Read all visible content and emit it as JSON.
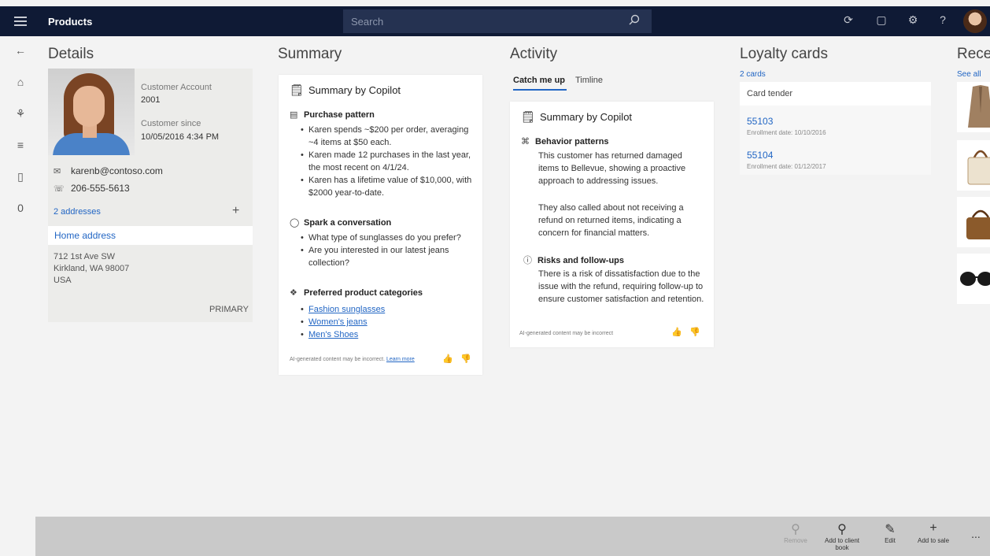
{
  "header": {
    "app_title": "Products",
    "search_placeholder": "Search",
    "icons": [
      "menu-icon",
      "search-icon",
      "refresh-icon",
      "chat-icon",
      "settings-icon",
      "help-icon",
      "avatar"
    ]
  },
  "rail": {
    "items": [
      "back-icon",
      "home-icon",
      "team-icon",
      "list-icon",
      "bag-icon",
      "zero-badge"
    ],
    "zero_label": "0"
  },
  "details": {
    "heading": "Details",
    "account_label": "Customer Account",
    "account_value": "2001",
    "since_label": "Customer since",
    "since_value": "10/05/2016 4:34 PM",
    "email": "karenb@contoso.com",
    "phone": "206-555-5613",
    "addresses_link": "2 addresses",
    "add_symbol": "+",
    "home_address_label": "Home address",
    "address_lines": [
      "712 1st Ave SW",
      "Kirkland, WA 98007",
      "USA"
    ],
    "primary_label": "PRIMARY"
  },
  "summary": {
    "heading": "Summary",
    "card_title": "Summary by Copilot",
    "purchase_title": "Purchase pattern",
    "purchase_bullets": [
      "Karen spends ~$200 per order, averaging ~4 items at $50 each.",
      "Karen made 12 purchases in the last year, the most recent on 4/1/24.",
      "Karen has a lifetime value of $10,000, with $2000 year-to-date."
    ],
    "conversation_title": "Spark a conversation",
    "conversation_bullets": [
      "What type of sunglasses do you prefer?",
      "Are you interested in our latest jeans collection?"
    ],
    "categories_title": "Preferred product categories",
    "categories": [
      "Fashion sunglasses",
      "Women's jeans",
      "Men's Shoes"
    ],
    "disclaimer": "AI-generated content may be incorrect.",
    "learn_more": "Learn more"
  },
  "activity": {
    "heading": "Activity",
    "tabs": [
      "Catch me up",
      "Timline"
    ],
    "card_title": "Summary by Copilot",
    "behavior_title": "Behavior patterns",
    "behavior_p1": "This customer has returned damaged items to Bellevue, showing a proactive approach to addressing issues.",
    "behavior_p2": "They also called about not receiving a refund on returned items, indicating a concern for financial matters.",
    "risks_title": "Risks and follow-ups",
    "risks_p": "There is a risk of dissatisfaction due to the issue with the refund, requiring follow-up to ensure customer satisfaction and retention.",
    "disclaimer": "AI-generated content may be incorrect"
  },
  "loyalty": {
    "heading": "Loyalty cards",
    "count_link": "2 cards",
    "tender_label": "Card tender",
    "cards": [
      {
        "number": "55103",
        "date": "Enrollment date: 10/10/2016"
      },
      {
        "number": "55104",
        "date": "Enrollment date: 01/12/2017"
      }
    ]
  },
  "recent": {
    "heading": "Rece",
    "see_all": "See all",
    "items": [
      "coat-thumbnail",
      "handbag-thumbnail",
      "brown-bag-thumbnail",
      "sunglasses-thumbnail"
    ]
  },
  "actions": {
    "remove": "Remove",
    "add_client_book": "Add to client book",
    "edit": "Edit",
    "add_to_sale": "Add to sale",
    "more": "..."
  },
  "colors": {
    "topbar": "#0f1a35",
    "accent": "#2266c4",
    "bottombar": "#c9c9c9"
  }
}
